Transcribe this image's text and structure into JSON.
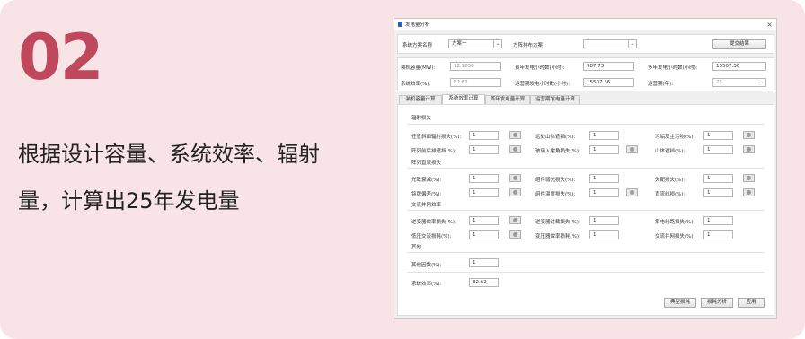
{
  "slide": {
    "number": "02",
    "desc_line1": "根据设计容量、系统效率、辐射",
    "desc_line2": "量，计算出25年发电量"
  },
  "window": {
    "title": "发电量分析",
    "close": "×"
  },
  "top": {
    "scheme_label": "系统方案名称",
    "scheme_value": "方案一",
    "array_label": "方阵排布方案",
    "array_value": "",
    "submit": "提交结果"
  },
  "summary": {
    "capacity_label": "装机容量(MW):",
    "capacity_value": "72.7056",
    "first_year_label": "首年发电小时数(小时):",
    "first_year_value": "987.73",
    "multi_year_label": "多年发电小时数(小时):",
    "multi_year_value": "15507.36",
    "efficiency_label": "系统效率(%):",
    "efficiency_value": "82.62",
    "op_hours_label": "运营期发电小时数(小时):",
    "op_hours_value": "15507.36",
    "op_period_label": "运营期(年):",
    "op_period_value": "25"
  },
  "tabs": [
    "装机容量计算",
    "系统效率计算",
    "首年发电量计算",
    "运营期发电量计算"
  ],
  "sections": {
    "radiation": "辐射损失",
    "dc": "阵列直流损失",
    "ac": "交流并网效率",
    "other": "其他"
  },
  "fields": {
    "tilt_loss": {
      "label": "任意斜面辐射损失(%):",
      "value": "1"
    },
    "far_shade": {
      "label": "远处山体遮挡(%):",
      "value": "1"
    },
    "dust": {
      "label": "污垢灰尘污物(%):",
      "value": "1"
    },
    "array_shade": {
      "label": "阵列前后排遮挡(%):",
      "value": "1"
    },
    "incidence": {
      "label": "玻璃入射角损失(%):",
      "value": "1"
    },
    "mountain_shade": {
      "label": "山体遮挡(%):",
      "value": "1"
    },
    "degradation": {
      "label": "光致衰减(%):",
      "value": "1"
    },
    "weak_light": {
      "label": "组件弱光损失(%):",
      "value": "1"
    },
    "mismatch": {
      "label": "失配损失(%):",
      "value": "1"
    },
    "deviation": {
      "label": "铭牌偏差(%):",
      "value": "1"
    },
    "temperature": {
      "label": "组件温度损失(%):",
      "value": "1"
    },
    "dc_line": {
      "label": "直流线损(%):",
      "value": "1"
    },
    "inverter": {
      "label": "逆变器效率损失(%):",
      "value": "1"
    },
    "overload": {
      "label": "逆变器过载损失(%):",
      "value": "1"
    },
    "collector": {
      "label": "集电线路损失(%):",
      "value": "1"
    },
    "lv_ac": {
      "label": "低压交流损耗(%):",
      "value": "1"
    },
    "transformer": {
      "label": "变压器效率损耗(%):",
      "value": "1"
    },
    "grid": {
      "label": "交流并网损失(%):",
      "value": "1"
    },
    "other_factor": {
      "label": "其他因数(%):",
      "value": "1"
    },
    "system_eff": {
      "label": "系统效率(%):",
      "value": "82.62"
    }
  },
  "actions": {
    "typical": "典型损耗",
    "analysis": "损耗分析",
    "apply": "应用"
  }
}
